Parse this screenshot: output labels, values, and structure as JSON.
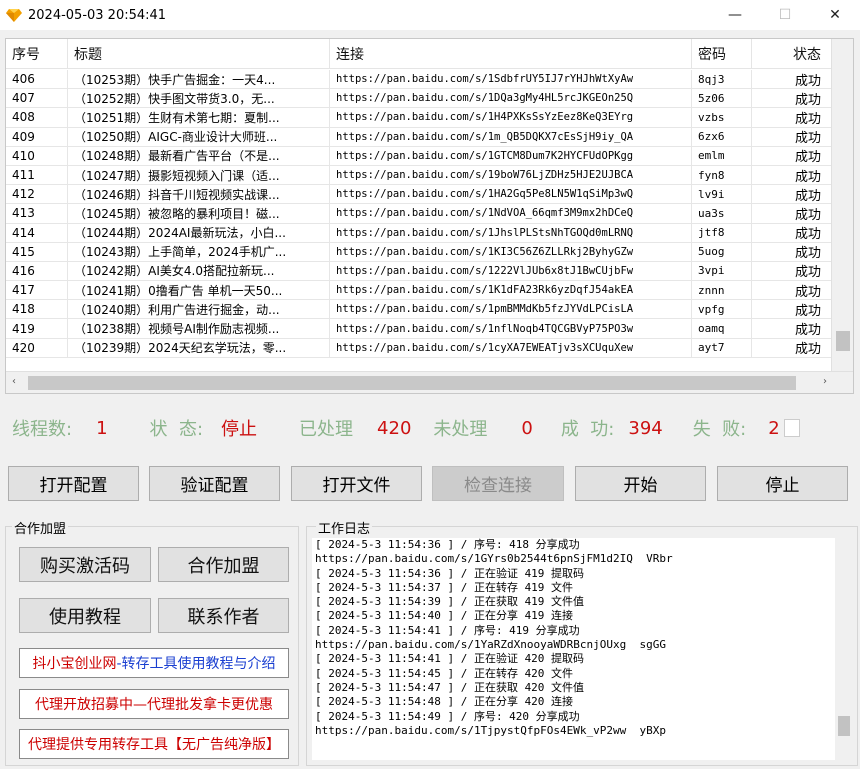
{
  "window": {
    "title": "2024-05-03 20:54:41",
    "minimize": "—",
    "maximize": "☐",
    "close": "✕"
  },
  "table": {
    "headers": [
      "序号",
      "标题",
      "连接",
      "密码",
      "状态"
    ],
    "rows": [
      {
        "num": "406",
        "title": "（10253期）快手广告掘金：一天4...",
        "link": "https://pan.baidu.com/s/1SdbfrUY5IJ7rYHJhWtXyAw",
        "pwd": "8qj3",
        "status": "成功"
      },
      {
        "num": "407",
        "title": "（10252期）快手图文带货3.0，无...",
        "link": "https://pan.baidu.com/s/1DQa3gMy4HL5rcJKGEOn25Q",
        "pwd": "5z06",
        "status": "成功"
      },
      {
        "num": "408",
        "title": "（10251期）生财有术第七期：夏制...",
        "link": "https://pan.baidu.com/s/1H4PXKsSsYzEez8KeQ3EYrg",
        "pwd": "vzbs",
        "status": "成功"
      },
      {
        "num": "409",
        "title": "（10250期）AIGC-商业设计大师班...",
        "link": "https://pan.baidu.com/s/1m_QB5DQKX7cEsSjH9iy_QA",
        "pwd": "6zx6",
        "status": "成功"
      },
      {
        "num": "410",
        "title": "（10248期）最新看广告平台（不是...",
        "link": "https://pan.baidu.com/s/1GTCM8Dum7K2HYCFUdOPKgg",
        "pwd": "emlm",
        "status": "成功"
      },
      {
        "num": "411",
        "title": "（10247期）摄影短视频入门课（适...",
        "link": "https://pan.baidu.com/s/19boW76LjZDHz5HJE2UJBCA",
        "pwd": "fyn8",
        "status": "成功"
      },
      {
        "num": "412",
        "title": "（10246期）抖音千川短视频实战课...",
        "link": "https://pan.baidu.com/s/1HA2Gq5Pe8LN5W1qSiMp3wQ",
        "pwd": "lv9i",
        "status": "成功"
      },
      {
        "num": "413",
        "title": "（10245期）被忽略的暴利项目！磁...",
        "link": "https://pan.baidu.com/s/1NdVOA_66qmf3M9mx2hDCeQ",
        "pwd": "ua3s",
        "status": "成功"
      },
      {
        "num": "414",
        "title": "（10244期）2024AI最新玩法，小白...",
        "link": "https://pan.baidu.com/s/1JhslPLStsNhTGOQd0mLRNQ",
        "pwd": "jtf8",
        "status": "成功"
      },
      {
        "num": "415",
        "title": "（10243期）上手简单，2024手机广...",
        "link": "https://pan.baidu.com/s/1KI3C56Z6ZLLRkj2ByhyGZw",
        "pwd": "5uog",
        "status": "成功"
      },
      {
        "num": "416",
        "title": "（10242期）AI美女4.0搭配拉新玩...",
        "link": "https://pan.baidu.com/s/1222VlJUb6x8tJ1BwCUjbFw",
        "pwd": "3vpi",
        "status": "成功"
      },
      {
        "num": "417",
        "title": "（10241期）0撸看广告 单机一天50...",
        "link": "https://pan.baidu.com/s/1K1dFA23Rk6yzDqfJ54akEA",
        "pwd": "znnn",
        "status": "成功"
      },
      {
        "num": "418",
        "title": "（10240期）利用广告进行掘金，动...",
        "link": "https://pan.baidu.com/s/1pmBMMdKb5fzJYVdLPCisLA",
        "pwd": "vpfg",
        "status": "成功"
      },
      {
        "num": "419",
        "title": "（10238期）视频号AI制作励志视频...",
        "link": "https://pan.baidu.com/s/1nflNoqb4TQCGBVyP75PO3w",
        "pwd": "oamq",
        "status": "成功"
      },
      {
        "num": "420",
        "title": "（10239期）2024天纪玄学玩法，零...",
        "link": "https://pan.baidu.com/s/1cyXA7EWEATjv3sXCUquXew",
        "pwd": "ayt7",
        "status": "成功"
      }
    ]
  },
  "stats": {
    "threads_label": "线程数:",
    "threads_value": "1",
    "state_label": "状  态:",
    "state_value": "停止",
    "processed_label": "已处理",
    "processed_value": "420",
    "unprocessed_label": "未处理",
    "unprocessed_value": "0",
    "success_label": "成  功:",
    "success_value": "394",
    "fail_label": "失  败:",
    "fail_value": "2"
  },
  "buttons": {
    "open_config": "打开配置",
    "verify_config": "验证配置",
    "open_file": "打开文件",
    "check_connection": "检查连接",
    "start": "开始",
    "stop": "停止"
  },
  "cooperation": {
    "group_title": "合作加盟",
    "buy_code": "购买激活码",
    "join": "合作加盟",
    "tutorial": "使用教程",
    "contact": "联系作者",
    "promo1_red": "抖小宝创业网",
    "promo1_blue": "-转存工具使用教程与介绍",
    "promo2": "代理开放招募中—代理批发拿卡更优惠",
    "promo3": "代理提供专用转存工具【无广告纯净版】"
  },
  "log": {
    "title": "工作日志",
    "lines": [
      "[ 2024-5-3 11:54:36 ] / 序号: 418 分享成功",
      "https://pan.baidu.com/s/1GYrs0b2544t6pnSjFM1d2IQ  VRbr",
      "[ 2024-5-3 11:54:36 ] / 正在验证 419 提取码",
      "[ 2024-5-3 11:54:37 ] / 正在转存 419 文件",
      "[ 2024-5-3 11:54:39 ] / 正在获取 419 文件值",
      "[ 2024-5-3 11:54:40 ] / 正在分享 419 连接",
      "[ 2024-5-3 11:54:41 ] / 序号: 419 分享成功",
      "https://pan.baidu.com/s/1YaRZdXnooyaWDRBcnjOUxg  sgGG",
      "[ 2024-5-3 11:54:41 ] / 正在验证 420 提取码",
      "[ 2024-5-3 11:54:45 ] / 正在转存 420 文件",
      "[ 2024-5-3 11:54:47 ] / 正在获取 420 文件值",
      "[ 2024-5-3 11:54:48 ] / 正在分享 420 连接",
      "[ 2024-5-3 11:54:49 ] / 序号: 420 分享成功",
      "https://pan.baidu.com/s/1TjpystQfpFOs4EWk_vP2ww  yBXp"
    ]
  },
  "colors": {
    "stat_label": "#8cb58c",
    "stat_value": "#cc1111",
    "promo_red": "#cc0000",
    "promo_blue": "#1a3fd1"
  }
}
